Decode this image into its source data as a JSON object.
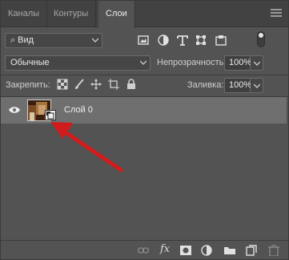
{
  "tabs": [
    {
      "label": "Каналы",
      "active": false
    },
    {
      "label": "Контуры",
      "active": false
    },
    {
      "label": "Слои",
      "active": true
    }
  ],
  "filter": {
    "value": "Вид",
    "icon": "search-icon"
  },
  "blend_mode": {
    "value": "Обычные"
  },
  "opacity": {
    "label": "Непрозрачность:",
    "value": "100%"
  },
  "lock": {
    "label": "Закрепить:"
  },
  "fill": {
    "label": "Заливка:",
    "value": "100%"
  },
  "layers": [
    {
      "name": "Слой 0",
      "visible": true,
      "smart_object": true,
      "selected": true
    }
  ],
  "bottom_icons": [
    "link-icon",
    "fx-icon",
    "mask-icon",
    "adjustment-icon",
    "folder-icon",
    "new-layer-icon",
    "trash-icon"
  ],
  "colors": {
    "panel": "#535353",
    "tabs": "#424242",
    "selected_row": "#6f6f6f",
    "annotation_arrow": "#d01c1c"
  }
}
